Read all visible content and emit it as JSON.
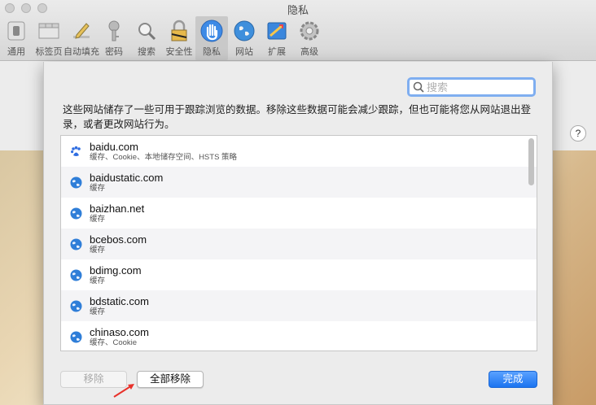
{
  "window": {
    "title": "隐私"
  },
  "toolbar": {
    "items": [
      {
        "label": "通用",
        "icon": "general-switch-icon"
      },
      {
        "label": "标签页",
        "icon": "tabs-icon"
      },
      {
        "label": "自动填充",
        "icon": "autofill-pencil-icon"
      },
      {
        "label": "密码",
        "icon": "key-icon"
      },
      {
        "label": "搜索",
        "icon": "magnifier-icon"
      },
      {
        "label": "安全性",
        "icon": "lock-icon"
      },
      {
        "label": "隐私",
        "icon": "hand-icon",
        "active": true
      },
      {
        "label": "网站",
        "icon": "globe-icon"
      },
      {
        "label": "扩展",
        "icon": "puzzle-icon"
      },
      {
        "label": "高级",
        "icon": "gear-icon"
      }
    ]
  },
  "sheet": {
    "search": {
      "placeholder": "搜索",
      "value": ""
    },
    "description": "这些网站储存了一些可用于跟踪浏览的数据。移除这些数据可能会减少跟踪，但也可能将您从网站退出登录，或者更改网站行为。",
    "websites": [
      {
        "domain": "baidu.com",
        "detail": "缓存、Cookie、本地储存空间、HSTS 策略",
        "icon": "baidu-paw-icon"
      },
      {
        "domain": "baidustatic.com",
        "detail": "缓存",
        "icon": "globe-icon"
      },
      {
        "domain": "baizhan.net",
        "detail": "缓存",
        "icon": "globe-icon"
      },
      {
        "domain": "bcebos.com",
        "detail": "缓存",
        "icon": "globe-icon"
      },
      {
        "domain": "bdimg.com",
        "detail": "缓存",
        "icon": "globe-icon"
      },
      {
        "domain": "bdstatic.com",
        "detail": "缓存",
        "icon": "globe-icon"
      },
      {
        "domain": "chinaso.com",
        "detail": "缓存、Cookie",
        "icon": "globe-icon"
      }
    ],
    "buttons": {
      "remove": "移除",
      "remove_all": "全部移除",
      "done": "完成"
    }
  },
  "colors": {
    "accent": "#1b74f0",
    "search_focus": "#7faef0",
    "arrow": "#e8312a"
  }
}
